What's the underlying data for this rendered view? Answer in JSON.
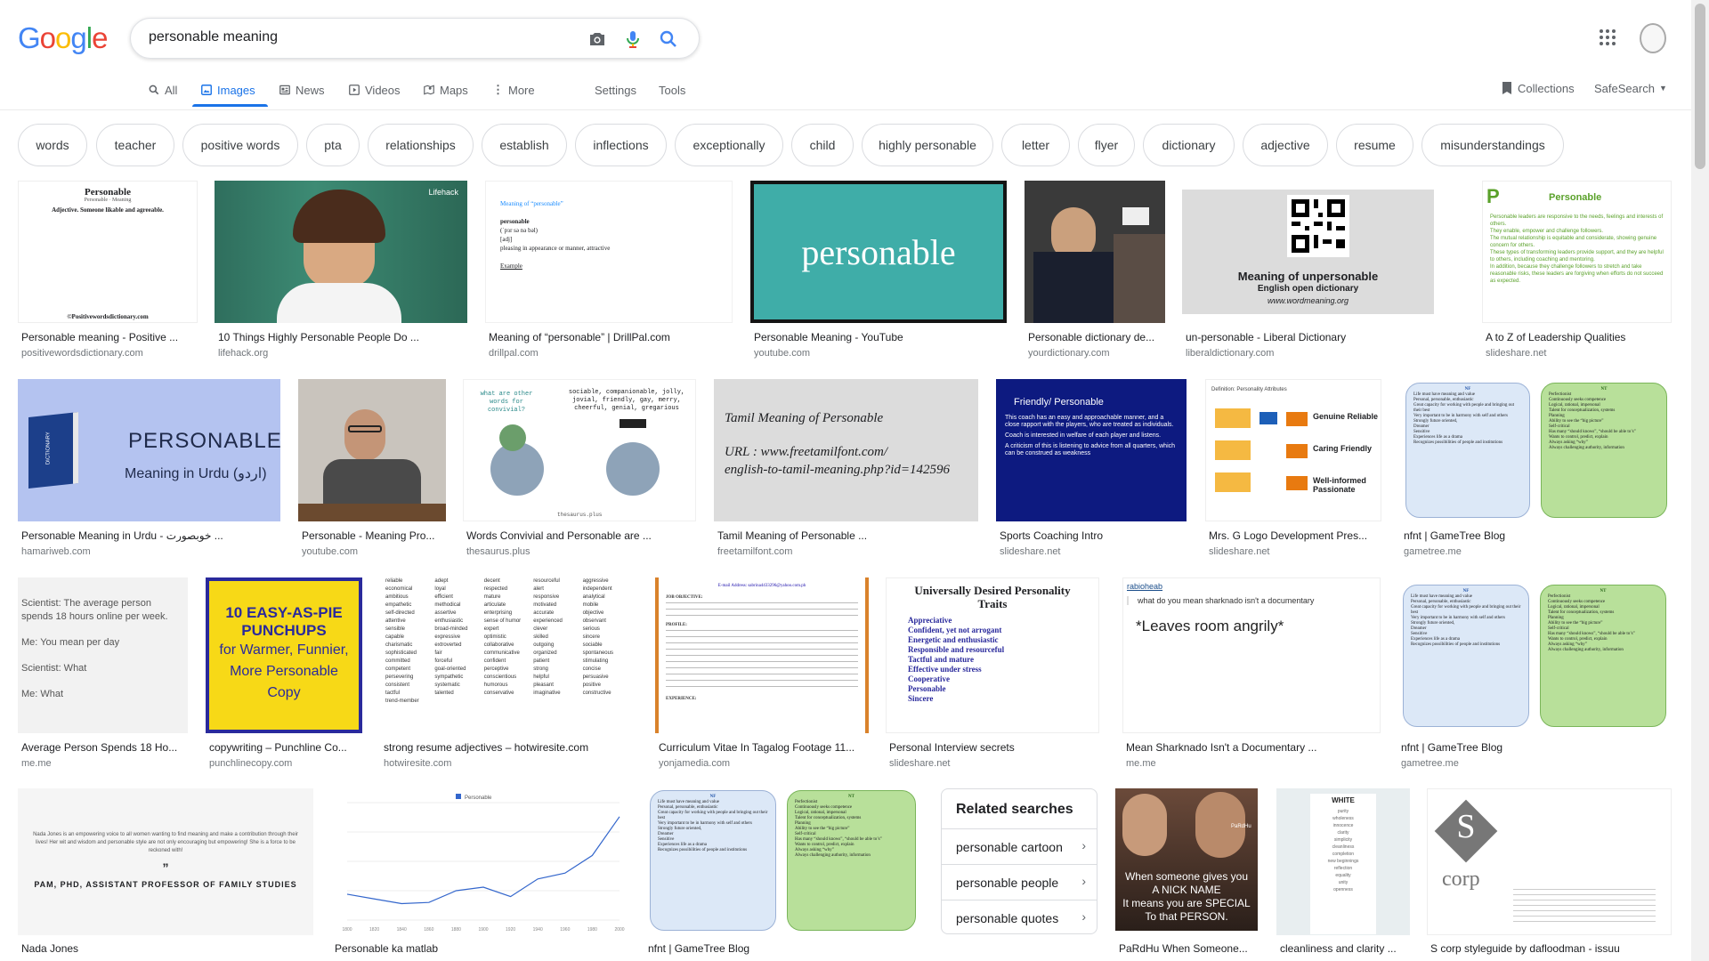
{
  "search": {
    "query": "personable meaning"
  },
  "logo": {
    "text": "Google"
  },
  "tabs": [
    {
      "label": "All",
      "icon": "search-icon"
    },
    {
      "label": "Images",
      "icon": "image-icon"
    },
    {
      "label": "News",
      "icon": "news-icon"
    },
    {
      "label": "Videos",
      "icon": "video-icon"
    },
    {
      "label": "Maps",
      "icon": "map-icon"
    },
    {
      "label": "More",
      "icon": "more-vert-icon"
    }
  ],
  "tools": {
    "settings": "Settings",
    "tools": "Tools"
  },
  "header_right": {
    "collections": "Collections",
    "safesearch": "SafeSearch"
  },
  "chips": [
    "words",
    "teacher",
    "positive words",
    "pta",
    "relationships",
    "establish",
    "inflections",
    "exceptionally",
    "child",
    "highly personable",
    "letter",
    "flyer",
    "dictionary",
    "adjective",
    "resume",
    "misunderstandings"
  ],
  "results": [
    {
      "caption": "Personable meaning - Positive ...",
      "source": "positivewordsdictionary.com"
    },
    {
      "caption": "10 Things Highly Personable People Do ...",
      "source": "lifehack.org"
    },
    {
      "caption": "Meaning of “personable” | DrillPal.com",
      "source": "drillpal.com"
    },
    {
      "caption": "Personable Meaning - YouTube",
      "source": "youtube.com"
    },
    {
      "caption": "Personable dictionary de...",
      "source": "yourdictionary.com"
    },
    {
      "caption": "un-personable - Liberal Dictionary",
      "source": "liberaldictionary.com"
    },
    {
      "caption": "A to Z of Leadership Qualities",
      "source": "slideshare.net"
    },
    {
      "caption": "Personable Meaning in Urdu - خوبصورت ...",
      "source": "hamariweb.com"
    },
    {
      "caption": "Personable - Meaning Pro...",
      "source": "youtube.com"
    },
    {
      "caption": "Words Convivial and Personable are ...",
      "source": "thesaurus.plus"
    },
    {
      "caption": "Tamil Meaning of Personable ...",
      "source": "freetamilfont.com"
    },
    {
      "caption": "Sports Coaching Intro",
      "source": "slideshare.net"
    },
    {
      "caption": "Mrs. G Logo Development Pres...",
      "source": "slideshare.net"
    },
    {
      "caption": "nfnt | GameTree Blog",
      "source": "gametree.me"
    },
    {
      "caption": "Average Person Spends 18 Ho...",
      "source": "me.me"
    },
    {
      "caption": "copywriting – Punchline Co...",
      "source": "punchlinecopy.com"
    },
    {
      "caption": "strong resume adjectives – hotwiresite.com",
      "source": "hotwiresite.com"
    },
    {
      "caption": "Curriculum Vitae In Tagalog Footage 11...",
      "source": "yonjamedia.com"
    },
    {
      "caption": "Personal Interview secrets",
      "source": "slideshare.net"
    },
    {
      "caption": "Mean Sharknado Isn't a Documentary ...",
      "source": "me.me"
    },
    {
      "caption": "nfnt | GameTree Blog",
      "source": "gametree.me"
    },
    {
      "caption": "Nada Jones",
      "source": ""
    },
    {
      "caption": "Personable ka matlab",
      "source": ""
    },
    {
      "caption": "nfnt | GameTree Blog",
      "source": ""
    },
    {
      "caption": "PaRdHu When Someone...",
      "source": ""
    },
    {
      "caption": "cleanliness and clarity ...",
      "source": ""
    },
    {
      "caption": "S corp styleguide by dafloodman - issuu",
      "source": ""
    }
  ],
  "thumb_text": {
    "pwd_title": "Personable",
    "pwd_sub": "Personable · Meaning",
    "pwd_def": "Adjective. Someone likable and agreeable.",
    "pwd_footer": "©Positivewordsdictionary.com",
    "lifehack": "Lifehack",
    "drill_title": "Meaning of “personable”",
    "drill_word": "personable",
    "drill_pron": "(ˈpɜr sə nə bəl)",
    "drill_pos": "[adj]",
    "drill_def": "pleasing in appearance or manner, attractive",
    "drill_example": "Example",
    "yt_word": "personable",
    "lib_title": "Meaning of unpersonable",
    "lib_sub": "English open dictionary",
    "lib_url": "www.wordmeaning.org",
    "lead_title": "Personable",
    "lead_lines": [
      "Personable leaders are responsive to the needs, feelings and interests of others.",
      "They enable, empower and challenge followers.",
      "The mutual relationship is equitable and considerate, showing genuine concern for others.",
      "These types of transforming leaders provide support, and they are helpful to others, including coaching and mentoring.",
      "In addition, because they challenge followers to stretch and take reasonable risks, these leaders are forgiving when efforts do not succeed as expected."
    ],
    "urdu_word": "PERSONABLE",
    "urdu_sub": "Meaning in Urdu (اردو)",
    "urdu_book": "DICTIONARY",
    "thes_q": "what are other words for convivial?",
    "thes_a": "sociable, companionable, jolly, jovial, friendly, gay, merry, cheerful, genial, gregarious",
    "thes_footer": "thesaurus.plus",
    "tamil_1": "Tamil Meaning of Personable",
    "tamil_2": "URL : www.freetamilfont.com/",
    "tamil_3": "english-to-tamil-meaning.php?id=142596",
    "sports_title": "Friendly/ Personable",
    "sports_1": "This coach has an easy and approachable manner, and a close rapport with the players, who are treated as individuals.",
    "sports_2": "Coach is interested in welfare of each player and listens.",
    "sports_3": "A criticism of this is listening to advice from all quarters, which can be construed as weakness",
    "mrsg_title": "Definition: Personality Attributes",
    "mrsg_1": "Genuine Reliable",
    "mrsg_2": "Caring Friendly",
    "mrsg_3": "Well-informed Passionate",
    "nf_label": "NF",
    "nt_label": "NT",
    "nf_lines": [
      "Life must have meaning and value",
      "Personal, personable, enthusiastic",
      "Great capacity for working with people and bringing out their best",
      "Very important to be in harmony with self and others",
      "Strongly future oriented,",
      "Dreamer",
      "Sensitive",
      "Experiences life as a drama",
      "Recognizes possibilities of people and institutions"
    ],
    "nt_lines": [
      "Perfectionist",
      "Continuously seeks competence",
      "Logical, rational, impersonal",
      "Talent for conceptualization, systems",
      "Planning",
      "Ability to see the “big picture”",
      "Self-critical",
      "Has many “should knows”, “should be able to’s”",
      "Wants to control, predict, explain",
      "Always asking “why”",
      "Always challenging authority, information"
    ],
    "avg_1": "Scientist: The average person spends 18 hours online per week.",
    "avg_2": "Me: You mean per day",
    "avg_3": "Scientist: What",
    "avg_4": "Me: What",
    "punch_1": "10 EASY-AS-PIE",
    "punch_2": "PUNCHUPS",
    "punch_3": "for Warmer, Funnier, More Personable Copy",
    "resume_words": [
      "reliable",
      "adept",
      "decent",
      "resourceful",
      "aggressive",
      "economical",
      "loyal",
      "respected",
      "alert",
      "independent",
      "ambitious",
      "efficient",
      "mature",
      "responsive",
      "analytical",
      "empathetic",
      "methodical",
      "articulate",
      "motivated",
      "mobile",
      "self-directed",
      "assertive",
      "enterprising",
      "accurate",
      "objective",
      "attentive",
      "enthusiastic",
      "sense of humor",
      "experienced",
      "observant",
      "sensible",
      "broad-minded",
      "expert",
      "clever",
      "serious",
      "capable",
      "expressive",
      "optimistic",
      "skilled",
      "sincere",
      "charismatic",
      "extroverted",
      "collaborative",
      "outgoing",
      "sociable",
      "sophisticated",
      "fair",
      "communicative",
      "organized",
      "spontaneous",
      "committed",
      "forceful",
      "confident",
      "patient",
      "stimulating",
      "competent",
      "goal-oriented",
      "perceptive",
      "strong",
      "concise",
      "persevering",
      "sympathetic",
      "conscientious",
      "helpful",
      "persuasive",
      "consistent",
      "systematic",
      "humorous",
      "pleasant",
      "positive",
      "tactful",
      "talented",
      "conservative",
      "imaginative",
      "constructive",
      "trend-member"
    ],
    "cv_email": "E-mail Address: sabrina4433296@yahoo.com.ph",
    "cv_obj": "JOB OBJECTIVE:",
    "cv_prof": "PROFILE:",
    "cv_exp": "EXPERIENCE:",
    "pi_title": "Universally Desired Personality Traits",
    "pi_items": [
      "Appreciative",
      "Confident, yet not arrogant",
      "Energetic and enthusiastic",
      "Responsible and resourceful",
      "Tactful and mature",
      "Effective under stress",
      "Cooperative",
      "Personable",
      "Sincere"
    ],
    "shark_user": "rabioheab",
    "shark_q": "what do you mean sharknado isn't a documentary",
    "shark_a": "*Leaves room angrily*",
    "nada_quote": "Nada Jones is an empowering voice to all women wanting to find meaning and make a contribution through their lives! Her wit and wisdom and personable style are not only encouraging but empowering! She is a force to be reckoned with!",
    "nada_attr": "PAM, PHD, ASSISTANT PROFESSOR OF FAMILY STUDIES",
    "pardhu_1": "When someone gives you",
    "pardhu_2": "A NICK NAME",
    "pardhu_3": "It means you are SPECIAL",
    "pardhu_4": "To that PERSON.",
    "pardhu_brand": "PaRdHu",
    "clean_title": "WHITE",
    "clean_words": [
      "purity",
      "wholeness",
      "innocence",
      "clarity",
      "simplicity",
      "cleanliness",
      "completion",
      "new beginnings",
      "reflection",
      "equality",
      "unity",
      "openness"
    ],
    "scorp_letter": "S",
    "scorp_word": "corp"
  },
  "related": {
    "title": "Related searches",
    "items": [
      "personable cartoon",
      "personable people",
      "personable quotes"
    ]
  },
  "chart_data": {
    "type": "line",
    "legend": "Personable",
    "x": [
      "1800",
      "1820",
      "1840",
      "1860",
      "1880",
      "1900",
      "1920",
      "1940",
      "1960",
      "1980",
      "2000"
    ],
    "values": [
      22,
      18,
      14,
      15,
      25,
      28,
      20,
      35,
      40,
      55,
      88
    ]
  },
  "colors": {
    "link_blue": "#1a73e8",
    "teal_bg": "#3fada8",
    "urdu_bg": "#b4c3f0",
    "sports_bg": "#0d1a80",
    "punch_bg": "#f7d917",
    "punch_border": "#2a2a9c",
    "nf_bg": "#dce8f7",
    "nt_bg": "#b8e09a"
  }
}
